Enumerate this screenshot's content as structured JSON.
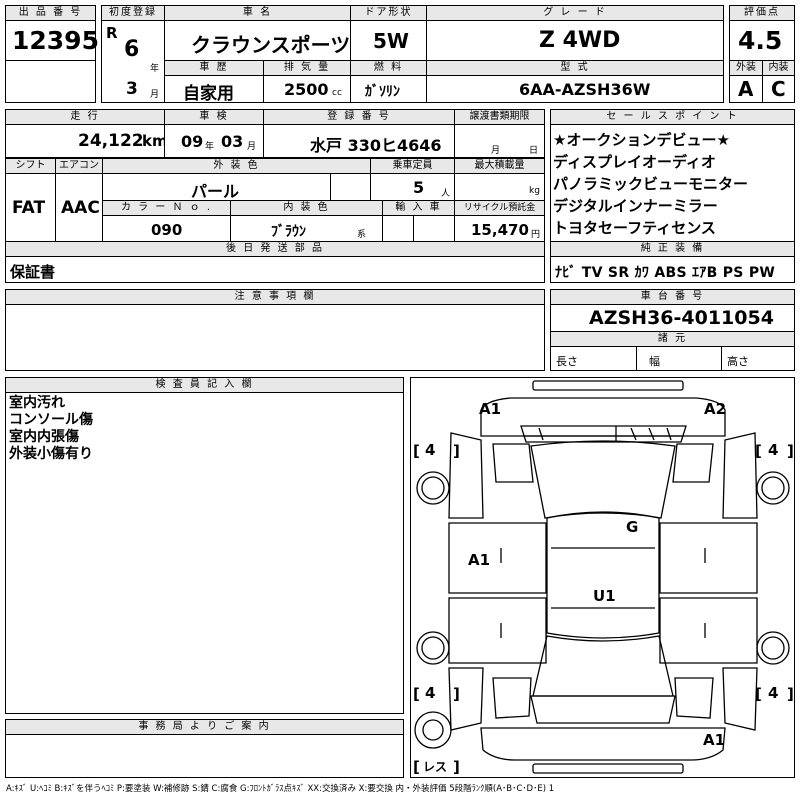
{
  "lot": {
    "header": "出 品 番 号",
    "number": "12395"
  },
  "first_reg": {
    "header": "初度登録",
    "era": "R",
    "year": "6",
    "year_unit": "年",
    "month": "3",
    "month_unit": "月"
  },
  "car_name": {
    "header": "車 名",
    "value": "クラウンスポーツ"
  },
  "door": {
    "header": "ドア形状",
    "value": "5W"
  },
  "grade": {
    "header": "グ レ ー ド",
    "value": "Z 4WD"
  },
  "score": {
    "header": "評価点",
    "value": "4.5"
  },
  "history": {
    "header": "車 歴",
    "value": "自家用"
  },
  "displacement": {
    "header": "排 気 量",
    "value": "2500",
    "unit": "cc"
  },
  "fuel": {
    "header": "燃 料",
    "value": "ｶﾞｿﾘﾝ"
  },
  "model": {
    "header": "型 式",
    "value": "6AA-AZSH36W"
  },
  "exterior_grade": {
    "header": "外装",
    "value": "A"
  },
  "interior_grade": {
    "header": "内装",
    "value": "C"
  },
  "mileage": {
    "header": "走 行",
    "value": "24,122",
    "unit": "km"
  },
  "inspection": {
    "header": "車 検",
    "year": "09",
    "year_unit": "年",
    "month": "03",
    "month_unit": "月"
  },
  "plate": {
    "header": "登 録 番 号",
    "value": "水戸 330ヒ4646"
  },
  "transfer": {
    "header": "譲渡書類期限",
    "month_unit": "月",
    "day_unit": "日"
  },
  "shift": {
    "header": "シフト",
    "value": "FAT"
  },
  "aircon": {
    "header": "エアコン",
    "value": "AAC"
  },
  "ext_color": {
    "header": "外 装 色",
    "value": "パール"
  },
  "capacity": {
    "header": "乗車定員",
    "value": "5",
    "unit": "人"
  },
  "max_load": {
    "header": "最大積載量",
    "unit": "kg"
  },
  "color_no": {
    "header": "カ ラ ー Ｎ ｏ .",
    "value": "090"
  },
  "int_color": {
    "header": "内 装 色",
    "value": "ﾌﾞﾗｳﾝ",
    "unit": "系"
  },
  "import": {
    "header": "輸 入 車"
  },
  "recycle": {
    "header": "リサイクル預託金",
    "value": "15,470",
    "unit": "円"
  },
  "sales_points": {
    "header": "セ ー ル ス ポ イ ン ト",
    "items": [
      "★オークションデビュー★",
      "ディスプレイオーディオ",
      "パノラミックビューモニター",
      "デジタルインナーミラー",
      "トヨタセーフティセンス"
    ]
  },
  "later_parts": {
    "header": "後 日 発 送 部 品",
    "value": "保証書"
  },
  "equipment": {
    "header": "純 正 装 備",
    "value": "ﾅﾋﾞ TV SR ｶﾜ ABS ｴｱB PS PW"
  },
  "notes": {
    "header": "注 意 事 項 欄"
  },
  "chassis": {
    "header": "車 台 番 号",
    "value": "AZSH36-4011054"
  },
  "specs": {
    "header": "諸 元",
    "length": "長さ",
    "width": "幅",
    "height": "高さ"
  },
  "inspector": {
    "header": "検 査 員 記 入 欄",
    "items": [
      "室内汚れ",
      "コンソール傷",
      "室内内張傷",
      "外装小傷有り"
    ]
  },
  "office": {
    "header": "事 務 局 よ り ご 案 内"
  },
  "diagram": {
    "marks": {
      "a1_top_left": "A1",
      "a2_top_right": "A2",
      "a1_left": "A1",
      "g_center": "G",
      "u1_center": "U1",
      "a1_bottom_right": "A1"
    },
    "tires": {
      "front_left": "4",
      "front_right": "4",
      "rear_left": "4",
      "rear_right": "4"
    },
    "spare": "レス"
  },
  "legend": "A:ｷｽﾞ U:ﾍｺﾐ B:ｷｽﾞを伴うﾍｺﾐ P:要塗装 W:補修跡 S:錆 C:腐食 G:ﾌﾛﾝﾄｶﾞﾗｽ点ｷｽﾞ XX:交換済み X:要交換 内・外装評価 5段階ﾗﾝｸ順(A･B･C･D･E) 1"
}
